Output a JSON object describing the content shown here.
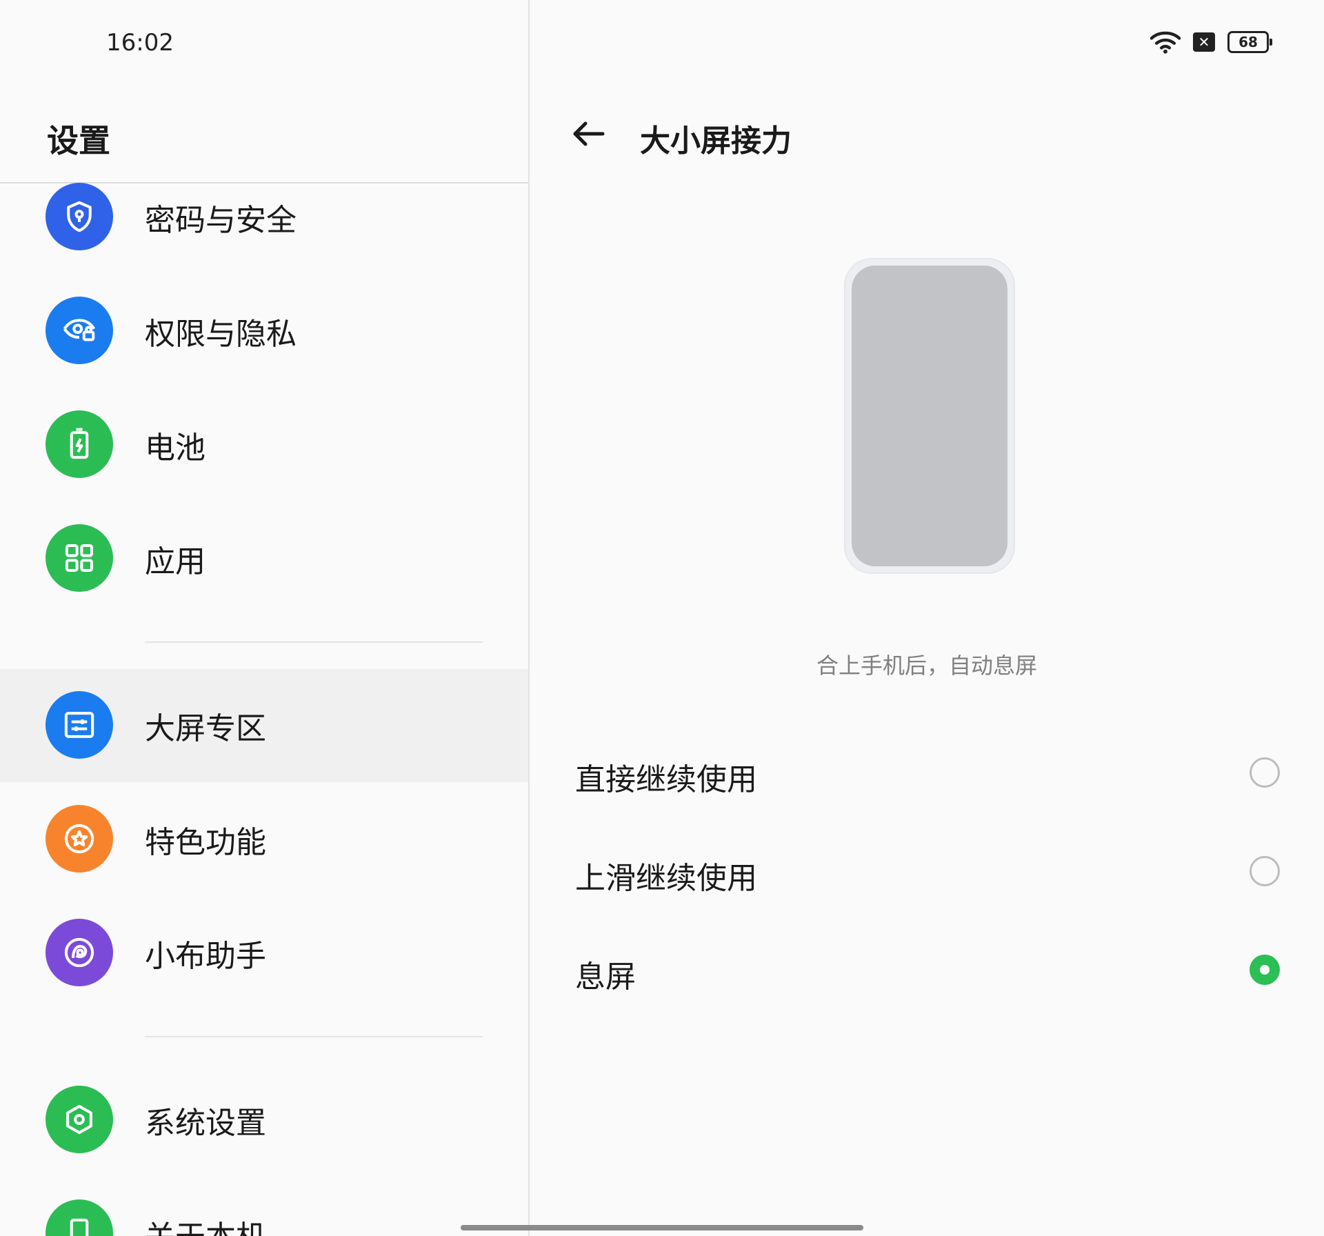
{
  "status_bar": {
    "time": "16:02",
    "battery": "68"
  },
  "left": {
    "title": "设置",
    "items": [
      {
        "label": "密码与安全",
        "icon": "shield-icon",
        "color": "#2f62e8"
      },
      {
        "label": "权限与隐私",
        "icon": "eye-lock-icon",
        "color": "#1b7cf0"
      },
      {
        "label": "电池",
        "icon": "battery-icon",
        "color": "#2bbd54"
      },
      {
        "label": "应用",
        "icon": "apps-grid-icon",
        "color": "#2bbd54"
      },
      {
        "label": "大屏专区",
        "icon": "sliders-icon",
        "color": "#1b7cf0"
      },
      {
        "label": "特色功能",
        "icon": "star-icon",
        "color": "#f7842c"
      },
      {
        "label": "小布助手",
        "icon": "assistant-icon",
        "color": "#7c4ad8"
      },
      {
        "label": "系统设置",
        "icon": "hexagon-gear-icon",
        "color": "#2bbd54"
      },
      {
        "label": "关于本机",
        "icon": "phone-icon",
        "color": "#2bbd54"
      }
    ]
  },
  "right": {
    "title": "大小屏接力",
    "caption": "合上手机后，自动息屏",
    "options": [
      {
        "label": "直接继续使用",
        "checked": false
      },
      {
        "label": "上滑继续使用",
        "checked": false
      },
      {
        "label": "息屏",
        "checked": true
      }
    ]
  }
}
